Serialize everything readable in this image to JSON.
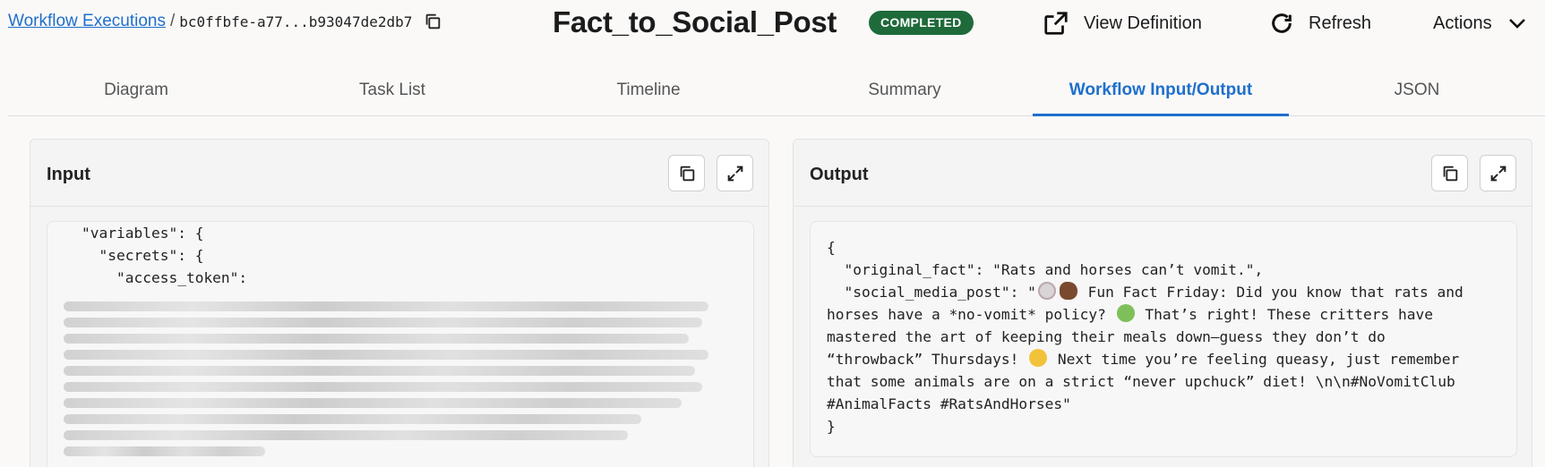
{
  "breadcrumb": {
    "parent": "Workflow Executions",
    "separator": "/",
    "execution_id": "bc0ffbfe-a77...b93047de2db7"
  },
  "header": {
    "title": "Fact_to_Social_Post",
    "status": "COMPLETED",
    "view_definition": "View Definition",
    "refresh": "Refresh",
    "actions": "Actions"
  },
  "tabs": [
    {
      "label": "Diagram",
      "active": false
    },
    {
      "label": "Task List",
      "active": false
    },
    {
      "label": "Timeline",
      "active": false
    },
    {
      "label": "Summary",
      "active": false
    },
    {
      "label": "Workflow Input/Output",
      "active": true
    },
    {
      "label": "JSON",
      "active": false
    }
  ],
  "input_panel": {
    "title": "Input",
    "lines": [
      "\"variables\": {",
      "  \"secrets\": {",
      "    \"access_token\":"
    ],
    "redacted_lines": 10
  },
  "output_panel": {
    "title": "Output",
    "lines": [
      "{",
      "  \"original_fact\": \"Rats and horses can’t vomit.\",",
      "  \"social_media_post\": \"",
      " Fun Fact Friday: Did you know that rats and",
      "horses have a *no-vomit* policy? ",
      " That’s right! These critters have",
      "mastered the art of keeping their meals down—guess they don’t do",
      "“throwback” Thursdays! ",
      " Next time you’re feeling queasy, just remember",
      "that some animals are on a strict “never upchuck” diet! \\n\\n#NoVomitClub",
      "#AnimalFacts #RatsAndHorses\"",
      "}"
    ]
  },
  "colors": {
    "link": "#1f6fcb",
    "status_badge": "#1f6a3a",
    "active_tab": "#1f6fcb"
  }
}
